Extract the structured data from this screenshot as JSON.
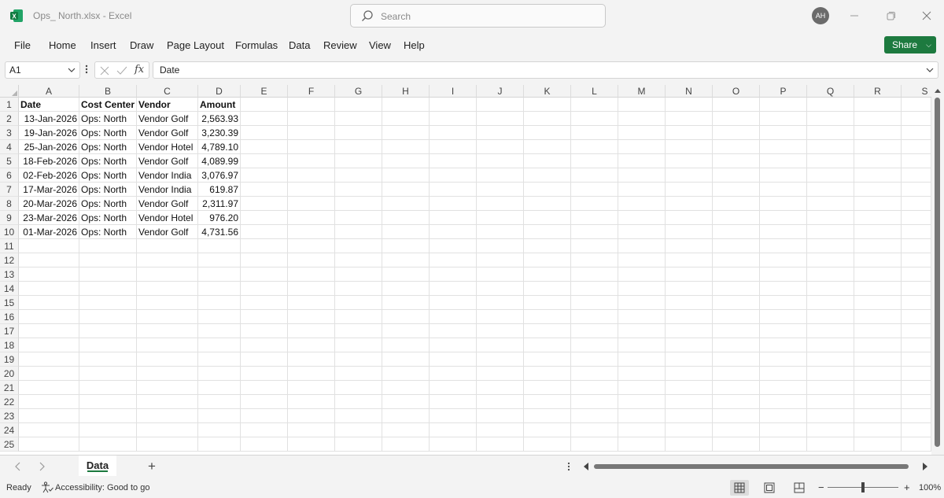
{
  "title_bar": {
    "document_title": "Ops_ North.xlsx  -  Excel",
    "search_placeholder": "Search",
    "avatar_initials": "AH"
  },
  "menu": {
    "items": [
      "File",
      "Home",
      "Insert",
      "Draw",
      "Page Layout",
      "Formulas",
      "Data",
      "Review",
      "View",
      "Help"
    ],
    "share_label": "Share"
  },
  "formula_bar": {
    "name_box": "A1",
    "fx_label": "fx",
    "content": "Date"
  },
  "grid": {
    "columns": [
      "A",
      "B",
      "C",
      "D",
      "E",
      "F",
      "G",
      "H",
      "I",
      "J",
      "K",
      "L",
      "M",
      "N",
      "O",
      "P",
      "Q",
      "R",
      "S"
    ],
    "row_numbers": [
      "1",
      "2",
      "3",
      "4",
      "5",
      "6",
      "7",
      "8",
      "9",
      "10",
      "11",
      "12",
      "13",
      "14",
      "15",
      "16",
      "17",
      "18",
      "19",
      "20",
      "21",
      "22",
      "23",
      "24",
      "25"
    ],
    "headers": [
      "Date",
      "Cost Center",
      "Vendor",
      "Amount"
    ],
    "rows": [
      [
        "13-Jan-2026",
        "Ops: North",
        "Vendor Golf",
        "2,563.93"
      ],
      [
        "19-Jan-2026",
        "Ops: North",
        "Vendor Golf",
        "3,230.39"
      ],
      [
        "25-Jan-2026",
        "Ops: North",
        "Vendor Hotel",
        "4,789.10"
      ],
      [
        "18-Feb-2026",
        "Ops: North",
        "Vendor Golf",
        "4,089.99"
      ],
      [
        "02-Feb-2026",
        "Ops: North",
        "Vendor India",
        "3,076.97"
      ],
      [
        "17-Mar-2026",
        "Ops: North",
        "Vendor India",
        "619.87"
      ],
      [
        "20-Mar-2026",
        "Ops: North",
        "Vendor Golf",
        "2,311.97"
      ],
      [
        "23-Mar-2026",
        "Ops: North",
        "Vendor Hotel",
        "976.20"
      ],
      [
        "01-Mar-2026",
        "Ops: North",
        "Vendor Golf",
        "4,731.56"
      ]
    ]
  },
  "sheet_tabs": {
    "active": "Data",
    "add_label": "+"
  },
  "status_bar": {
    "ready": "Ready",
    "accessibility": "Accessibility: Good to go",
    "zoom_minus": "−",
    "zoom_plus": "+",
    "zoom_level": "100%"
  },
  "colors": {
    "accent_green": "#1d7a3f",
    "excel_green": "#107c41"
  }
}
